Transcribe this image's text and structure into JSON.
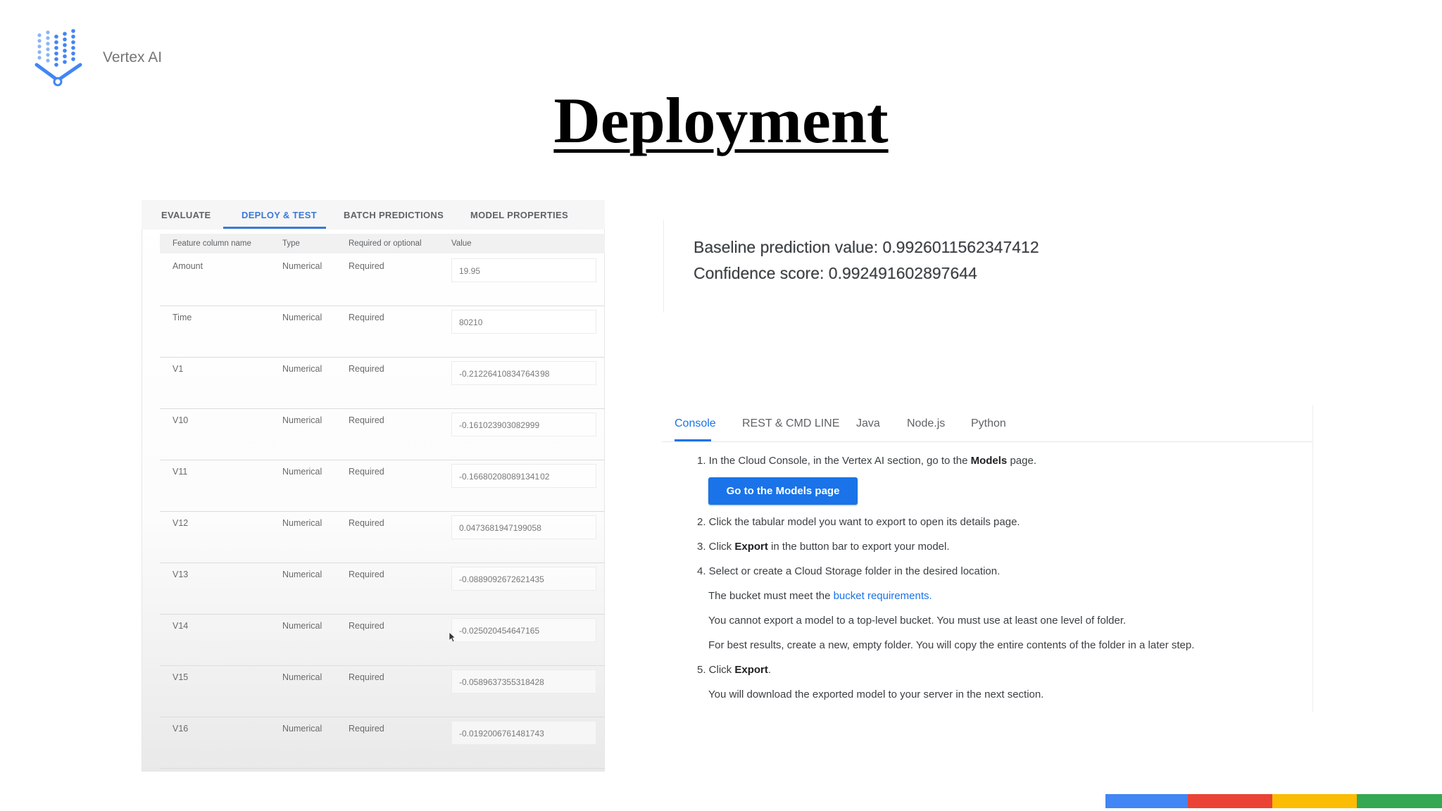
{
  "brand": {
    "name": "Vertex AI"
  },
  "slide": {
    "title": "Deployment"
  },
  "left_panel": {
    "tabs": [
      {
        "label": "EVALUATE",
        "active": false
      },
      {
        "label": "DEPLOY & TEST",
        "active": true
      },
      {
        "label": "BATCH PREDICTIONS",
        "active": false
      },
      {
        "label": "MODEL PROPERTIES",
        "active": false
      }
    ],
    "columns": [
      "Feature column name",
      "Type",
      "Required or optional",
      "Value"
    ],
    "rows": [
      {
        "name": "Amount",
        "type": "Numerical",
        "required": "Required",
        "value": "19.95"
      },
      {
        "name": "Time",
        "type": "Numerical",
        "required": "Required",
        "value": "80210"
      },
      {
        "name": "V1",
        "type": "Numerical",
        "required": "Required",
        "value": "-0.212264108347643 98"
      },
      {
        "name": "V10",
        "type": "Numerical",
        "required": "Required",
        "value": "-0.161023903082999"
      },
      {
        "name": "V11",
        "type": "Numerical",
        "required": "Required",
        "value": "-0.166802080891341 02"
      },
      {
        "name": "V12",
        "type": "Numerical",
        "required": "Required",
        "value": "0.0473681947199058"
      },
      {
        "name": "V13",
        "type": "Numerical",
        "required": "Required",
        "value": "-0.0889092672621435"
      },
      {
        "name": "V14",
        "type": "Numerical",
        "required": "Required",
        "value": "-0.025020454647165"
      },
      {
        "name": "V15",
        "type": "Numerical",
        "required": "Required",
        "value": "-0.0589637355318428"
      },
      {
        "name": "V16",
        "type": "Numerical",
        "required": "Required",
        "value": "-0.0192006761481743"
      }
    ]
  },
  "prediction": {
    "baseline": "Baseline prediction value: 0.9926011562347412",
    "confidence": "Confidence score: 0.992491602897644"
  },
  "right_panel": {
    "tabs": [
      {
        "label": "Console",
        "active": true
      },
      {
        "label": "REST & CMD LINE",
        "active": false
      },
      {
        "label": "Java",
        "active": false
      },
      {
        "label": "Node.js",
        "active": false
      },
      {
        "label": "Python",
        "active": false
      }
    ],
    "step1_pre": "1. In the Cloud Console, in the Vertex AI section, go to the ",
    "step1_bold": "Models",
    "step1_post": " page.",
    "button": "Go to the Models page",
    "step2": "2. Click the tabular model you want to export to open its details page.",
    "step3_pre": "3. Click ",
    "step3_bold": "Export",
    "step3_post": " in the button bar to export your model.",
    "step4": "4. Select or create a Cloud Storage folder in the desired location.",
    "note1_pre": "The bucket must meet the ",
    "note1_link": "bucket requirements.",
    "note2": "You cannot export a model to a top-level bucket. You must use at least one level of folder.",
    "note3": "For best results, create a new, empty folder. You will copy the entire contents of the folder in a later step.",
    "step5_pre": "5. Click ",
    "step5_bold": "Export",
    "step5_post": ".",
    "note4": "You will download the exported model to your server in the next section."
  },
  "colors": {
    "accent": "#1a73e8",
    "tab_active_left": "#3c78d8",
    "google_blue": "#4285f4",
    "google_red": "#ea4335",
    "google_yellow": "#fbbc04",
    "google_green": "#34a853"
  }
}
